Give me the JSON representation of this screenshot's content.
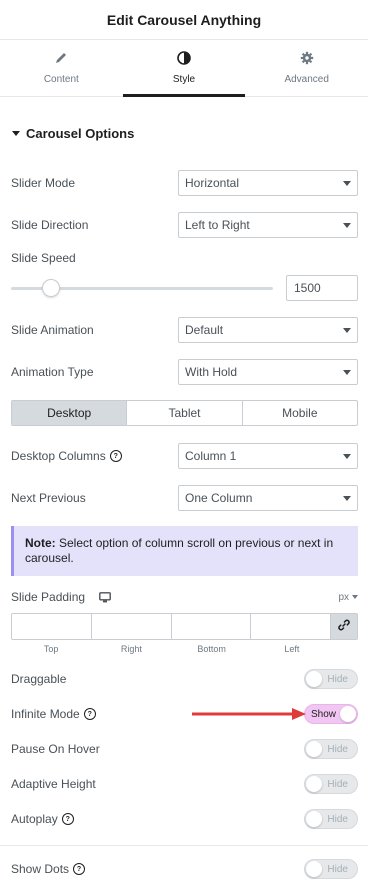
{
  "header": {
    "title": "Edit Carousel Anything"
  },
  "tabs": [
    {
      "label": "Content",
      "icon": "pencil-icon"
    },
    {
      "label": "Style",
      "icon": "contrast-icon",
      "active": true
    },
    {
      "label": "Advanced",
      "icon": "gear-icon"
    }
  ],
  "section": {
    "title": "Carousel Options"
  },
  "fields": {
    "slider_mode": {
      "label": "Slider Mode",
      "value": "Horizontal"
    },
    "slide_direction": {
      "label": "Slide Direction",
      "value": "Left to Right"
    },
    "slide_speed": {
      "label": "Slide Speed",
      "value": "1500"
    },
    "slide_animation": {
      "label": "Slide Animation",
      "value": "Default"
    },
    "animation_type": {
      "label": "Animation Type",
      "value": "With Hold"
    },
    "devices": {
      "desktop": "Desktop",
      "tablet": "Tablet",
      "mobile": "Mobile",
      "selected": "Desktop"
    },
    "desktop_columns": {
      "label": "Desktop Columns",
      "value": "Column 1"
    },
    "next_previous": {
      "label": "Next Previous",
      "value": "One Column"
    },
    "note": {
      "bold": "Note:",
      "text": " Select option of column scroll on previous or next in carousel."
    },
    "slide_padding": {
      "label": "Slide Padding",
      "unit": "px",
      "top": "Top",
      "right": "Right",
      "bottom": "Bottom",
      "left": "Left"
    },
    "draggable": {
      "label": "Draggable",
      "state": "Hide"
    },
    "infinite_mode": {
      "label": "Infinite Mode",
      "state": "Show"
    },
    "pause_on_hover": {
      "label": "Pause On Hover",
      "state": "Hide"
    },
    "adaptive_height": {
      "label": "Adaptive Height",
      "state": "Hide"
    },
    "autoplay": {
      "label": "Autoplay",
      "state": "Hide"
    },
    "show_dots": {
      "label": "Show Dots",
      "state": "Hide"
    }
  },
  "colors": {
    "accent_toggle_on": "#f1c6f2",
    "note_bg": "#e4e2fb",
    "annotation_arrow": "#e03b3b"
  }
}
